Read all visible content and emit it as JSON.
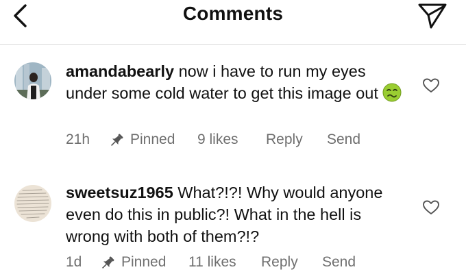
{
  "header": {
    "title": "Comments",
    "back_icon": "chevron-left-icon",
    "send_icon": "paper-plane-icon"
  },
  "comments": [
    {
      "username": "amandabearly",
      "text": " now i have to run my eyes under some cold water to get this image out",
      "emoji": "nauseated-face-emoji",
      "time": "21h",
      "pinned": "Pinned",
      "likes": "9 likes",
      "reply": "Reply",
      "send": "Send"
    },
    {
      "username": "sweetsuz1965",
      "text": " What?!?! Why would anyone even do this in public?! What in the hell is wrong with both of them?!?",
      "time": "1d",
      "pinned": "Pinned",
      "likes": "11 likes",
      "reply": "Reply",
      "send": "Send"
    }
  ],
  "colors": {
    "text": "#111111",
    "meta": "#6f6f6f",
    "divider": "#d8d8d8"
  }
}
